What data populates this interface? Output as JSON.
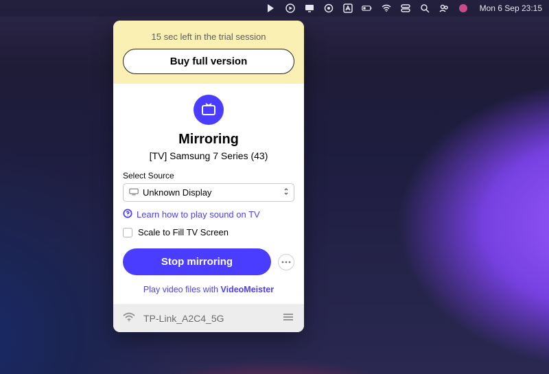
{
  "menubar": {
    "datetime": "Mon 6 Sep  23:15"
  },
  "trial": {
    "message": "15 sec left in the trial session",
    "buy_label": "Buy full version"
  },
  "main": {
    "title": "Mirroring",
    "device": "[TV] Samsung 7 Series (43)",
    "source_label": "Select Source",
    "source_value": "Unknown Display",
    "help_text": "Learn how to play sound on TV",
    "scale_label": "Scale to Fill TV Screen",
    "stop_label": "Stop mirroring",
    "promo_prefix": "Play video files with ",
    "promo_brand": "VideoMeister"
  },
  "footer": {
    "network": "TP-Link_A2C4_5G"
  }
}
